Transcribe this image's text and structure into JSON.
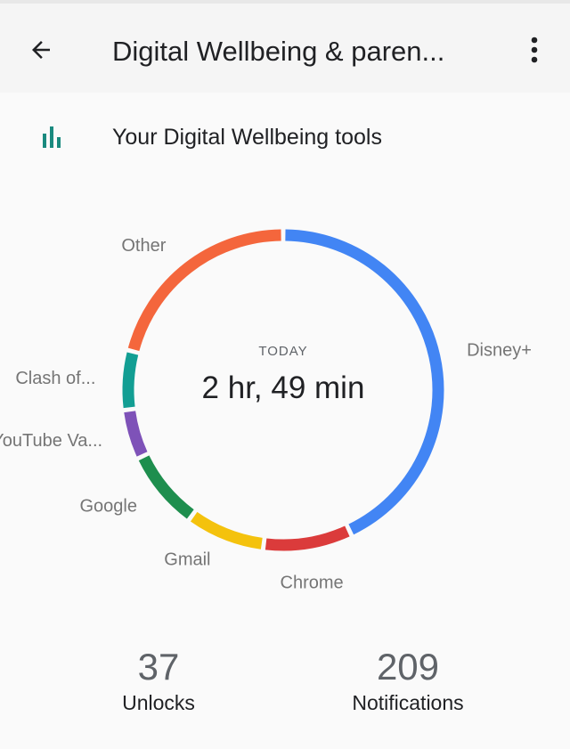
{
  "appbar": {
    "title": "Digital Wellbeing & paren...",
    "back_icon": "arrow-back-icon",
    "menu_icon": "more-vert-icon"
  },
  "tools_row": {
    "label": "Your Digital Wellbeing tools",
    "icon": "bar-chart-icon",
    "icon_color": "#1a8a7f"
  },
  "usage": {
    "caption": "TODAY",
    "total": "2 hr, 49 min"
  },
  "chart_data": {
    "type": "pie",
    "donut": true,
    "categories": [
      "Disney+",
      "Chrome",
      "Gmail",
      "Google",
      "YouTube Va...",
      "Clash of...",
      "Other"
    ],
    "values": [
      43,
      9,
      8,
      8,
      5,
      6,
      21
    ],
    "colors": [
      "#4285f4",
      "#db3b3b",
      "#f4c20d",
      "#1e8e4e",
      "#7e52b8",
      "#129e93",
      "#f4663c"
    ],
    "start_angle_deg": 0,
    "direction": "clockwise",
    "legend": "labels-around-ring"
  },
  "stats": {
    "unlocks_value": "37",
    "unlocks_label": "Unlocks",
    "notifications_value": "209",
    "notifications_label": "Notifications"
  }
}
